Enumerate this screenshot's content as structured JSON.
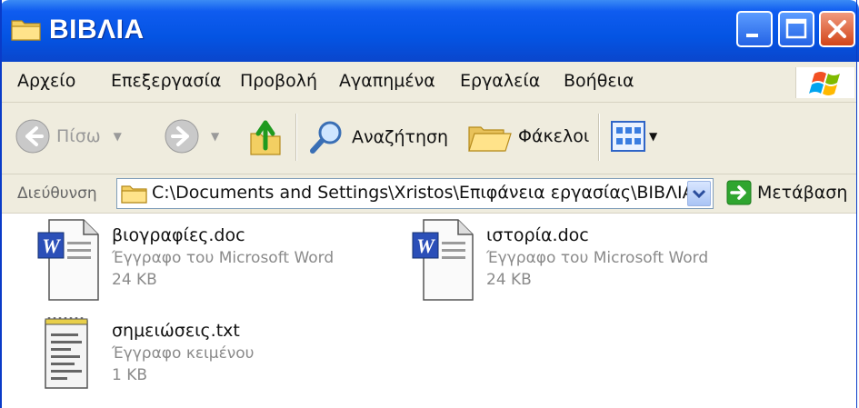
{
  "window": {
    "title": "ΒΙΒΛΙΑ",
    "title_icon": "folder-icon",
    "controls": [
      "minimize-icon",
      "maximize-icon",
      "close-icon"
    ]
  },
  "menu": {
    "items": [
      {
        "label": "Αρχείο"
      },
      {
        "label": "Επεξεργασία"
      },
      {
        "label": "Προβολή"
      },
      {
        "label": "Αγαπημένα"
      },
      {
        "label": "Εργαλεία"
      },
      {
        "label": "Βοήθεια"
      }
    ],
    "logo": "windows-logo-icon"
  },
  "toolbar": {
    "back_label": "Πίσω",
    "search_label": "Αναζήτηση",
    "folders_label": "Φάκελοι",
    "icons": [
      "back-arrow-icon",
      "forward-arrow-icon",
      "folder-up-icon",
      "search-icon",
      "folders-icon",
      "views-icon"
    ]
  },
  "address": {
    "label": "Διεύθυνση",
    "path": "C:\\Documents and Settings\\Xristos\\Επιφάνεια εργασίας\\ΒΙΒΛΙΑ",
    "go_label": "Μετάβαση"
  },
  "files": [
    {
      "name": "βιογραφίες.doc",
      "type": "Έγγραφο του Microsoft Word",
      "size": "24 KB",
      "icon": "word-document-icon"
    },
    {
      "name": "ιστορία.doc",
      "type": "Έγγραφο του Microsoft Word",
      "size": "24 KB",
      "icon": "word-document-icon"
    },
    {
      "name": "σημειώσεις.txt",
      "type": "Έγγραφο κειμένου",
      "size": "1 KB",
      "icon": "text-document-icon"
    }
  ],
  "colors": {
    "titlebar": "#0454e3",
    "chrome": "#efecde",
    "close_button": "#d24518"
  }
}
